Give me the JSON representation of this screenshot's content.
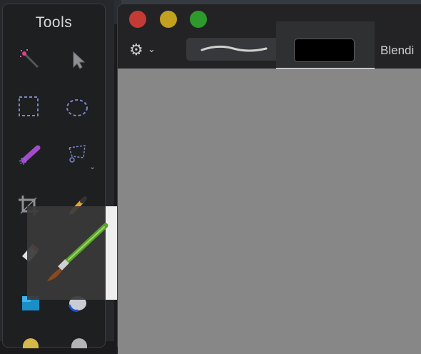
{
  "tools_panel": {
    "title": "Tools",
    "tools": [
      {
        "name": "magic-wand"
      },
      {
        "name": "move-arrow"
      },
      {
        "name": "rect-select"
      },
      {
        "name": "ellipse-select"
      },
      {
        "name": "color-picker"
      },
      {
        "name": "lasso"
      },
      {
        "name": "crop"
      },
      {
        "name": "pencil"
      },
      {
        "name": "eraser"
      },
      {
        "name": "paintbrush",
        "selected": true
      },
      {
        "name": "fill-rect"
      },
      {
        "name": "paint-bucket"
      }
    ]
  },
  "window": {
    "toolbar": {
      "settings_icon": "gear-icon",
      "blending_label": "Blendi",
      "current_color": "#000000"
    }
  },
  "colors": {
    "canvas": "#878787",
    "close": "#c43b35",
    "minimize": "#c2a121",
    "zoom": "#2f9a2c"
  }
}
